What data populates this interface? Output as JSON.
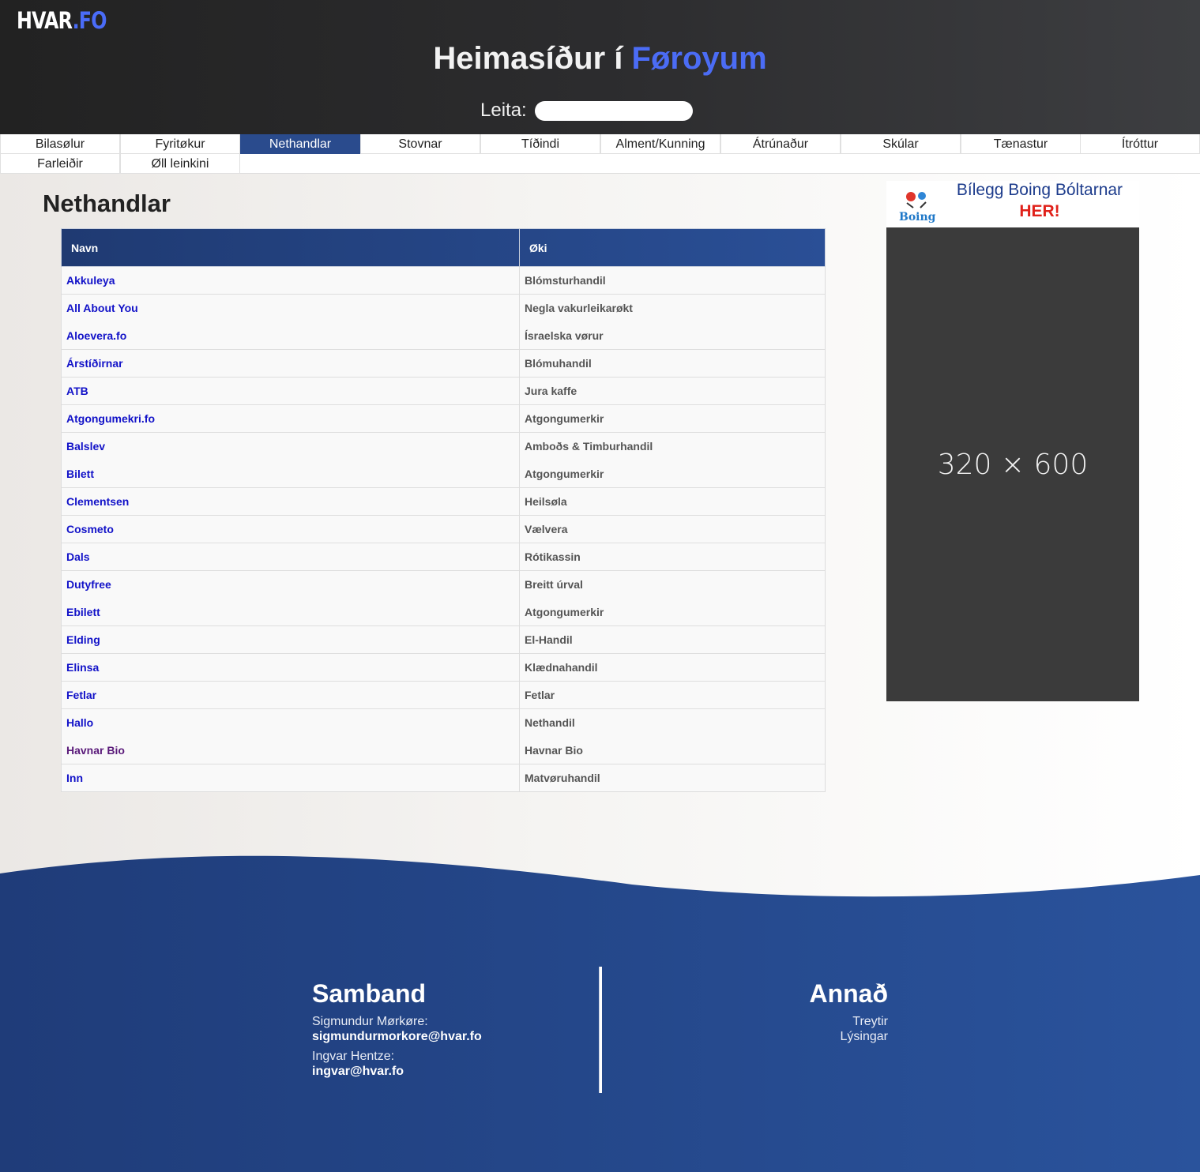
{
  "header": {
    "logo_main": "HVAR",
    "logo_accent": ".FO",
    "title_main": "Heimasíður í",
    "title_accent": "Føroyum",
    "search_label": "Leita:",
    "search_value": ""
  },
  "nav": {
    "items": [
      {
        "label": "Bilasølur"
      },
      {
        "label": "Fyritøkur"
      },
      {
        "label": "Nethandlar"
      },
      {
        "label": "Stovnar"
      },
      {
        "label": "Tíðindi"
      },
      {
        "label": "Alment/Kunning"
      },
      {
        "label": "Átrúnaður"
      },
      {
        "label": "Skúlar"
      },
      {
        "label": "Tænastur"
      },
      {
        "label": "Ítróttur"
      },
      {
        "label": "Farleiðir"
      },
      {
        "label": "Øll leinkini"
      }
    ],
    "active": "Nethandlar"
  },
  "main": {
    "heading": "Nethandlar",
    "table": {
      "headers": [
        "Navn",
        "Øki"
      ],
      "rows": [
        {
          "name": "Akkuleya",
          "category": "Blómsturhandil"
        },
        {
          "name": "All About You",
          "category": "Negla vakurleikarøkt"
        },
        {
          "name": "Aloevera.fo",
          "category": "Ísraelska vørur"
        },
        {
          "name": "Árstíðirnar",
          "category": "Blómuhandil"
        },
        {
          "name": "ATB",
          "category": "Jura kaffe"
        },
        {
          "name": "Atgongumekri.fo",
          "category": "Atgongumerkir"
        },
        {
          "name": "Balslev",
          "category": "Amboðs & Timburhandil"
        },
        {
          "name": "Bilett",
          "category": "Atgongumerkir"
        },
        {
          "name": "Clementsen",
          "category": "Heilsøla"
        },
        {
          "name": "Cosmeto",
          "category": "Vælvera"
        },
        {
          "name": "Dals",
          "category": "Rótikassin"
        },
        {
          "name": "Dutyfree",
          "category": "Breitt úrval"
        },
        {
          "name": "Ebilett",
          "category": "Atgongumerkir"
        },
        {
          "name": "Elding",
          "category": "El-Handil"
        },
        {
          "name": "Elinsa",
          "category": "Klædnahandil"
        },
        {
          "name": "Fetlar",
          "category": "Fetlar"
        },
        {
          "name": "Hallo",
          "category": "Nethandil"
        },
        {
          "name": "Havnar Bio",
          "category": "Havnar Bio"
        },
        {
          "name": "Inn",
          "category": "Matvøruhandil"
        }
      ]
    }
  },
  "ad": {
    "logo_text": "Boing",
    "title": "Bílegg Boing Bóltarnar",
    "subtitle": "HER!",
    "placeholder": "320 × 600"
  },
  "footer": {
    "contact": {
      "heading": "Samband",
      "people": [
        {
          "name": "Sigmundur Mørkøre:",
          "email": "sigmundurmorkore@hvar.fo"
        },
        {
          "name": "Ingvar Hentze:",
          "email": "ingvar@hvar.fo"
        }
      ]
    },
    "other": {
      "heading": "Annað",
      "links": [
        "Treytir",
        "Lýsingar"
      ]
    }
  },
  "colors": {
    "accent": "#4b6cf5",
    "nav_active": "#2a4b8d",
    "footer": "#24458a",
    "link": "#1212c8"
  }
}
